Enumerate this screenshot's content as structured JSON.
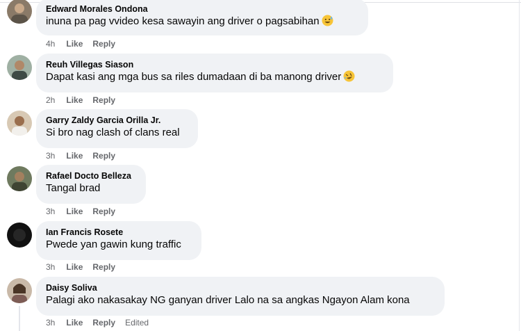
{
  "colors": {
    "bubble": "#f0f2f5",
    "meta": "#65676b",
    "text": "#050505"
  },
  "comments": [
    {
      "author": "Edward Morales Ondona",
      "text": "inuna pa pag vvideo kesa sawayin ang driver o pagsabihan",
      "emoji": "grinning-sweat-emoji",
      "time": "4h",
      "like": "Like",
      "reply": "Reply"
    },
    {
      "author": "Reuh Villegas Siason",
      "text": "Dapat kasi ang mga bus sa riles dumadaan di ba manong driver",
      "emoji": "rofl-emoji",
      "time": "2h",
      "like": "Like",
      "reply": "Reply"
    },
    {
      "author": "Garry Zaldy Garcia Orilla Jr.",
      "text": "Si bro nag clash of clans real",
      "time": "3h",
      "like": "Like",
      "reply": "Reply"
    },
    {
      "author": "Rafael Docto Belleza",
      "text": "Tangal brad",
      "time": "3h",
      "like": "Like",
      "reply": "Reply"
    },
    {
      "author": "Ian Francis Rosete",
      "text": "Pwede yan gawin kung traffic",
      "time": "3h",
      "like": "Like",
      "reply": "Reply"
    },
    {
      "author": "Daisy Soliva",
      "text": "Palagi ako nakasakay NG ganyan driver Lalo na sa angkas Ngayon Alam kona",
      "time": "3h",
      "like": "Like",
      "reply": "Reply",
      "edited": "Edited"
    }
  ]
}
